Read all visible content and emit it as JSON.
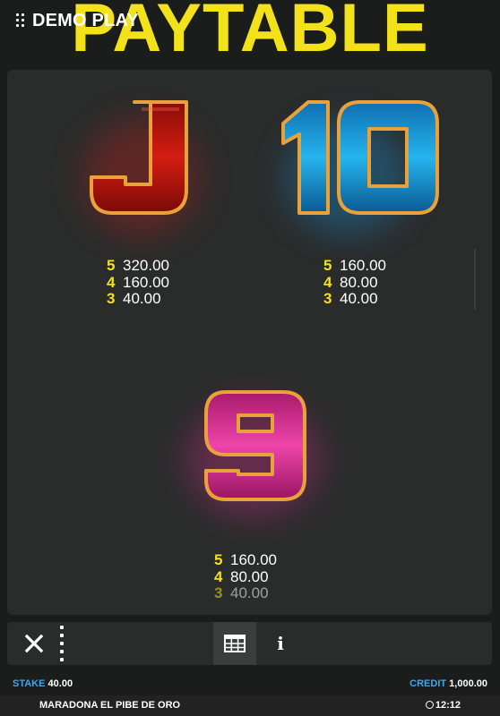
{
  "header": {
    "mode_label": "DEMO PLAY",
    "title": "PAYTABLE"
  },
  "symbols": [
    {
      "name": "J",
      "glyph": "J",
      "color": "#d01810",
      "payouts": [
        {
          "count": "5",
          "value": "320.00"
        },
        {
          "count": "4",
          "value": "160.00"
        },
        {
          "count": "3",
          "value": "40.00"
        }
      ]
    },
    {
      "name": "10",
      "glyph": "10",
      "color": "#1aa0e0",
      "payouts": [
        {
          "count": "5",
          "value": "160.00"
        },
        {
          "count": "4",
          "value": "80.00"
        },
        {
          "count": "3",
          "value": "40.00"
        }
      ]
    },
    {
      "name": "9",
      "glyph": "9",
      "color": "#e0309a",
      "payouts": [
        {
          "count": "5",
          "value": "160.00"
        },
        {
          "count": "4",
          "value": "80.00"
        },
        {
          "count": "3",
          "value": "40.00"
        }
      ]
    }
  ],
  "toolbar": {
    "close_icon": "close-icon",
    "more_icon": "vertical-dots-icon",
    "paytable_tab_icon": "table-grid-icon",
    "info_tab_icon": "info-icon",
    "info_label": "i"
  },
  "status": {
    "stake_label": "STAKE",
    "stake_value": "40.00",
    "credit_label": "CREDIT",
    "credit_value": "1,000.00"
  },
  "footer": {
    "game_name": "MARADONA EL PIBE DE ORO",
    "time": "12:12"
  },
  "colors": {
    "accent_yellow": "#f3e21a",
    "label_blue": "#4aa3df",
    "panel_bg": "#2a2b2b",
    "page_bg": "#1b1c1c"
  }
}
